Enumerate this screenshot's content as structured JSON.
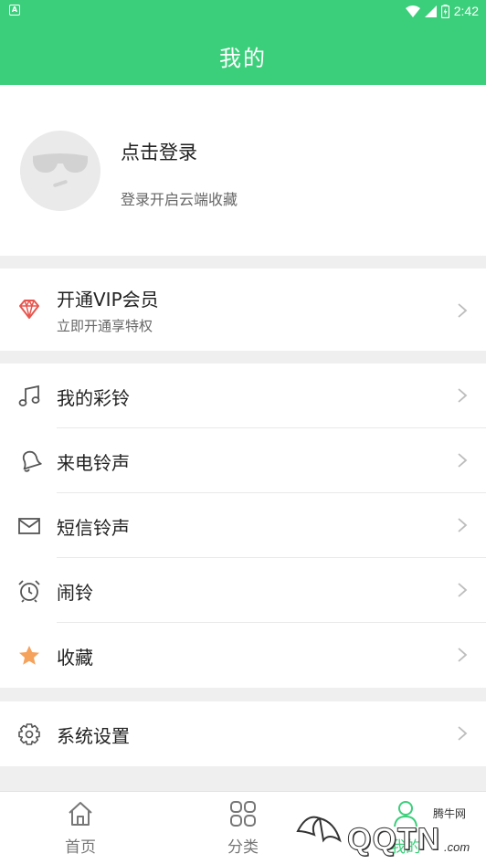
{
  "status_bar": {
    "time": "2:42",
    "app_badge": "A"
  },
  "header": {
    "title": "我的"
  },
  "profile": {
    "login_title": "点击登录",
    "login_subtitle": "登录开启云端收藏"
  },
  "vip": {
    "title": "开通VIP会员",
    "subtitle": "立即开通享特权",
    "icon": "diamond-icon",
    "icon_color": "#e8554e"
  },
  "menu": [
    {
      "label": "我的彩铃",
      "icon": "music-note-icon"
    },
    {
      "label": "来电铃声",
      "icon": "bell-icon"
    },
    {
      "label": "短信铃声",
      "icon": "envelope-icon"
    },
    {
      "label": "闹铃",
      "icon": "alarm-clock-icon"
    },
    {
      "label": "收藏",
      "icon": "star-icon",
      "icon_color": "#f5a25d"
    }
  ],
  "settings": {
    "label": "系统设置",
    "icon": "gear-icon"
  },
  "tabbar": {
    "items": [
      {
        "label": "首页",
        "icon": "home-icon"
      },
      {
        "label": "分类",
        "icon": "grid-icon"
      },
      {
        "label": "我的",
        "icon": "person-icon",
        "active": true
      }
    ]
  },
  "watermark": {
    "brand": "QQTN",
    "cn_text": "腾牛网",
    "domain": ".com"
  },
  "colors": {
    "primary": "#3ccf7b",
    "text": "#222222",
    "subtext": "#666666"
  }
}
